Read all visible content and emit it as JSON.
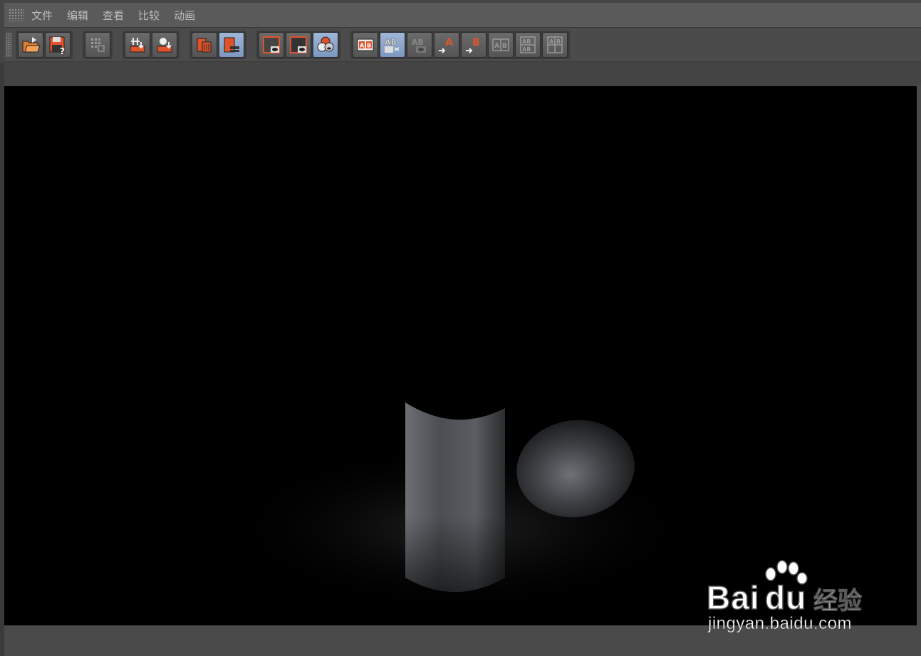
{
  "menu": {
    "items": [
      "文件",
      "编辑",
      "查看",
      "比较",
      "动画"
    ]
  },
  "toolbar": {
    "buttons": [
      {
        "name": "open-image-button",
        "icon": "open-folder-icon"
      },
      {
        "name": "save-image-button",
        "icon": "save-disk-icon"
      },
      {
        "name": "grid-options-button",
        "icon": "grid-icon"
      },
      {
        "name": "keep-image-button",
        "icon": "keep-image-icon"
      },
      {
        "name": "remove-image-button",
        "icon": "remove-image-icon"
      },
      {
        "name": "delete-image-button",
        "icon": "trash-icon"
      },
      {
        "name": "delete-all-button",
        "icon": "trash-list-icon"
      },
      {
        "name": "display-rgb-button",
        "icon": "display-eye-icon"
      },
      {
        "name": "display-alpha-button",
        "icon": "display-alpha-eye-icon"
      },
      {
        "name": "color-channels-button",
        "icon": "rgb-circles-icon"
      },
      {
        "name": "ab-compare-button",
        "icon": "ab-compare-icon"
      },
      {
        "name": "ab-wipe-button",
        "icon": "ab-wipe-icon"
      },
      {
        "name": "ab-overlay-button",
        "icon": "ab-overlay-icon"
      },
      {
        "name": "set-a-button",
        "icon": "set-a-icon"
      },
      {
        "name": "set-b-button",
        "icon": "set-b-icon"
      },
      {
        "name": "ab-horizontal-button",
        "icon": "ab-horizontal-icon"
      },
      {
        "name": "ab-vertical-button",
        "icon": "ab-vertical-icon"
      },
      {
        "name": "ab-quad-button",
        "icon": "ab-quad-icon"
      }
    ],
    "active": [
      "delete-all-button",
      "color-channels-button",
      "ab-wipe-button"
    ]
  },
  "watermark": {
    "brand_latin": "Bai",
    "brand_paw": "du",
    "brand_cn": "经验",
    "url": "jingyan.baidu.com"
  },
  "colors": {
    "accent_orange": "#e0532a",
    "active_blue": "#8aa6cc",
    "viewport_bg": "#000000"
  }
}
